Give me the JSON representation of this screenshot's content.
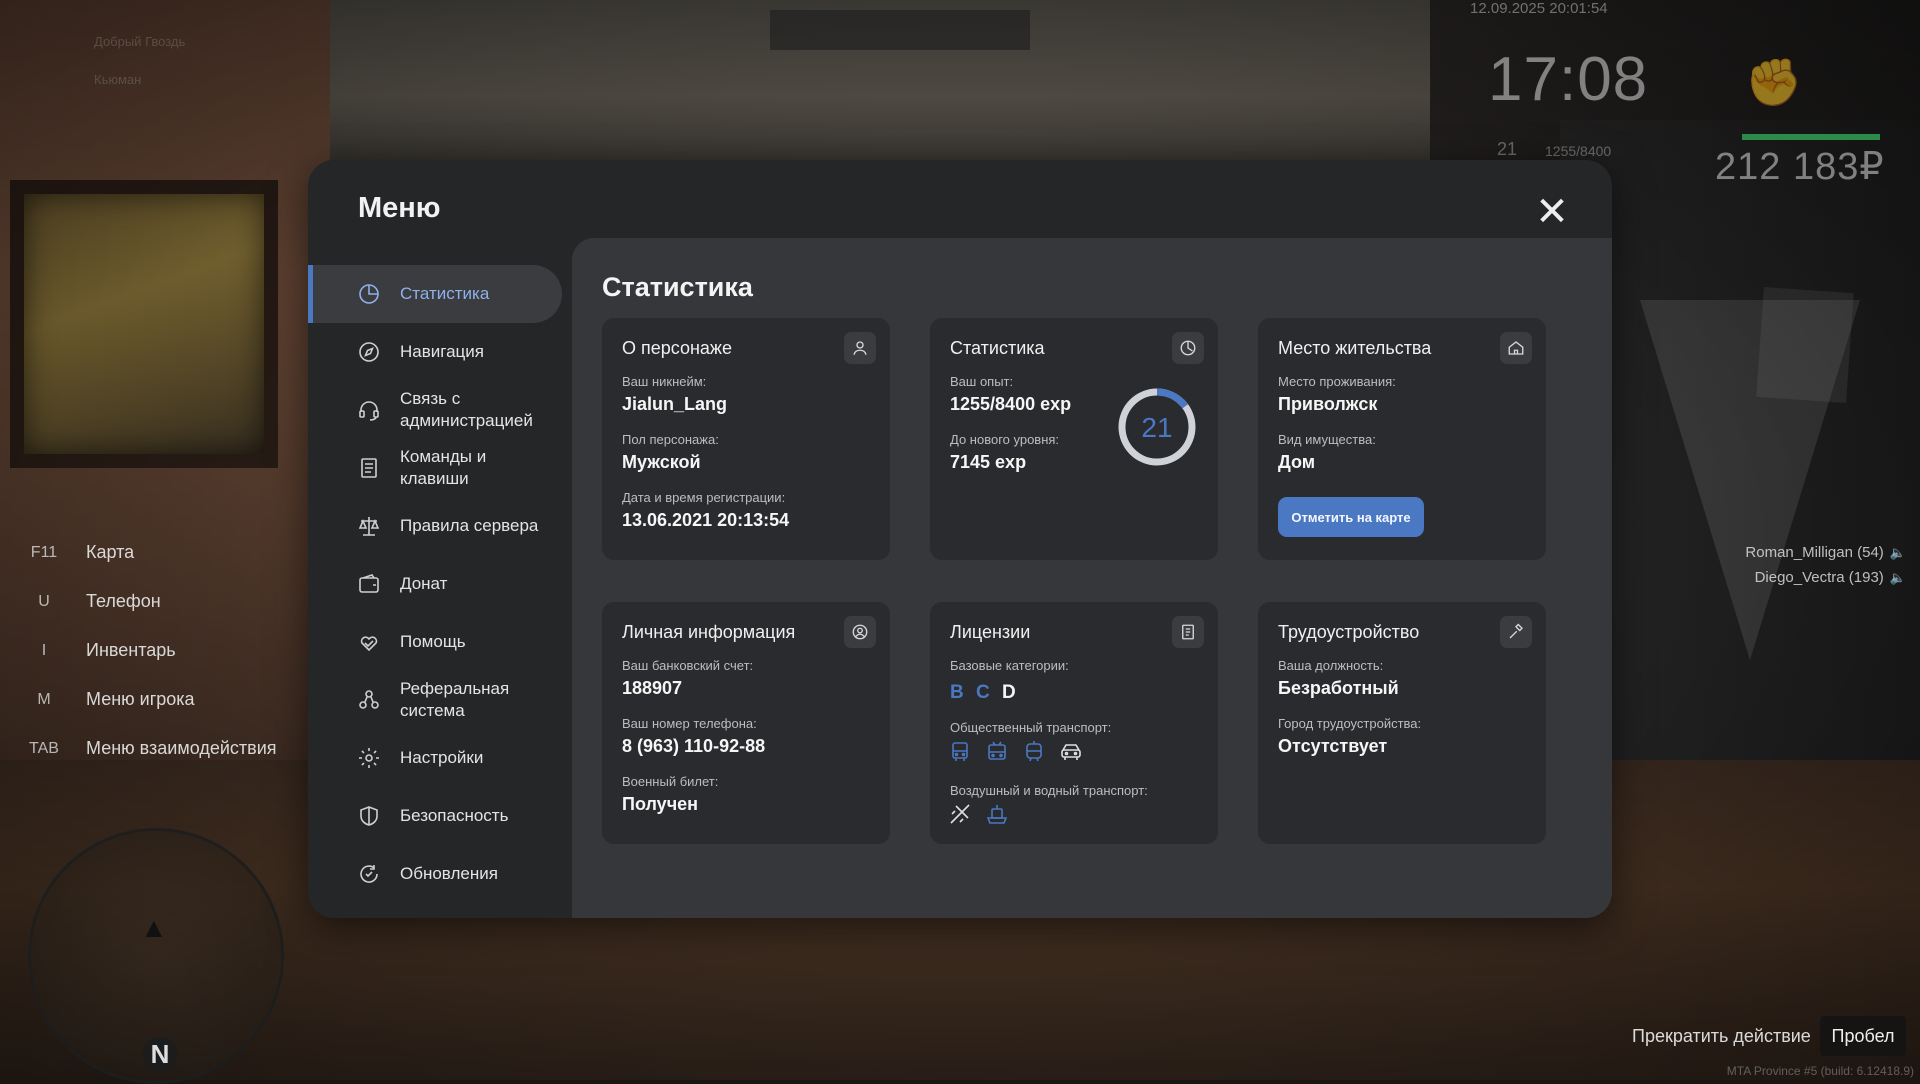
{
  "hud": {
    "datetime": "12.09.2025 20:01:54",
    "time": "17:08",
    "level": "21",
    "exp": "1255/8400",
    "money": "212 183₽",
    "chat_faint_1": "Добрый Гвоздь",
    "chat_faint_2": "Кьюман"
  },
  "hotkeys": [
    {
      "key": "F11",
      "label": "Карта"
    },
    {
      "key": "U",
      "label": "Телефон"
    },
    {
      "key": "I",
      "label": "Инвентарь"
    },
    {
      "key": "M",
      "label": "Меню игрока"
    },
    {
      "key": "TAB",
      "label": "Меню взаимодействия"
    }
  ],
  "players": [
    {
      "name": "Roman_Milligan (54)"
    },
    {
      "name": "Diego_Vectra (193)"
    }
  ],
  "minimap": {
    "north": "N"
  },
  "action": {
    "label": "Прекратить действие",
    "key": "Пробел"
  },
  "build": "MTA Province #5 (build: 6.12418.9)",
  "menu": {
    "title": "Меню",
    "close": "✕",
    "nav": [
      {
        "label": "Статистика",
        "icon": "pie-chart-icon",
        "active": true
      },
      {
        "label": "Навигация",
        "icon": "compass-icon"
      },
      {
        "label": "Связь с администрацией",
        "icon": "headset-icon"
      },
      {
        "label": "Команды и клавиши",
        "icon": "document-icon"
      },
      {
        "label": "Правила сервера",
        "icon": "scales-icon"
      },
      {
        "label": "Донат",
        "icon": "wallet-icon"
      },
      {
        "label": "Помощь",
        "icon": "heart-hands-icon"
      },
      {
        "label": "Реферальная система",
        "icon": "referral-icon"
      },
      {
        "label": "Настройки",
        "icon": "gear-icon"
      },
      {
        "label": "Безопасность",
        "icon": "shield-icon"
      },
      {
        "label": "Обновления",
        "icon": "refresh-icon"
      }
    ]
  },
  "content": {
    "title": "Статистика",
    "character": {
      "title": "О персонаже",
      "nickname_label": "Ваш никнейм:",
      "nickname": "Jialun_Lang",
      "gender_label": "Пол персонажа:",
      "gender": "Мужской",
      "reg_label": "Дата и время регистрации:",
      "reg": "13.06.2021 20:13:54"
    },
    "stats": {
      "title": "Статистика",
      "exp_label": "Ваш опыт:",
      "exp": "1255/8400 exp",
      "next_label": "До нового уровня:",
      "next": "7145 exp",
      "level": "21",
      "progress": 0.149
    },
    "residence": {
      "title": "Место жительства",
      "place_label": "Место проживания:",
      "place": "Приволжск",
      "property_label": "Вид имущества:",
      "property": "Дом",
      "button": "Отметить на карте"
    },
    "personal": {
      "title": "Личная информация",
      "bank_label": "Ваш банковский счет:",
      "bank": "188907",
      "phone_label": "Ваш номер телефона:",
      "phone": "8 (963) 110-92-88",
      "military_label": "Военный билет:",
      "military": "Получен"
    },
    "licenses": {
      "title": "Лицензии",
      "basic_label": "Базовые категории:",
      "categories": [
        {
          "name": "B",
          "color": "#4a78c2"
        },
        {
          "name": "C",
          "color": "#4a78c2"
        },
        {
          "name": "D",
          "color": "#f4f4f4"
        }
      ],
      "public_label": "Общественный транспорт:",
      "public_icons": [
        "bus-icon",
        "trolleybus-icon",
        "tram-icon",
        "taxi-icon"
      ],
      "air_label": "Воздушный и водный транспорт:",
      "air_icons": [
        "plane-icon",
        "boat-icon"
      ]
    },
    "employment": {
      "title": "Трудоустройство",
      "position_label": "Ваша должность:",
      "position": "Безработный",
      "city_label": "Город трудоустройства:",
      "city": "Отсутствует"
    }
  },
  "colors": {
    "accent": "#4a78c2",
    "panel": "#252628",
    "content": "#35373a",
    "card": "#2a2b2e"
  }
}
